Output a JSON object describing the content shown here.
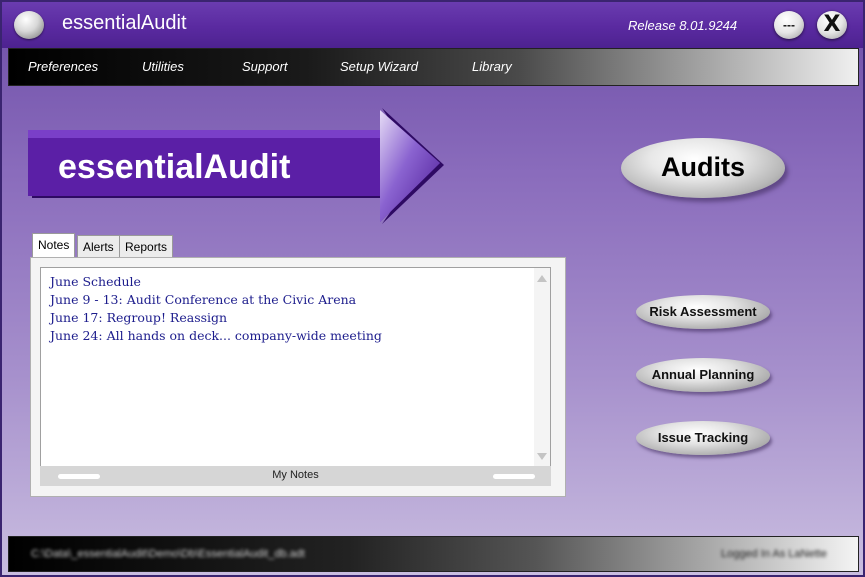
{
  "window": {
    "title": "essentialAudit",
    "release": "Release 8.01.9244",
    "minimize_label": "---",
    "close_label": "X"
  },
  "menu": {
    "items": [
      {
        "label": "Preferences"
      },
      {
        "label": "Utilities"
      },
      {
        "label": "Support"
      },
      {
        "label": "Setup Wizard"
      },
      {
        "label": "Library"
      }
    ]
  },
  "logo": {
    "text": "essentialAudit"
  },
  "buttons": {
    "audits": "Audits",
    "risk_assessment": "Risk Assessment",
    "annual_planning": "Annual Planning",
    "issue_tracking": "Issue Tracking"
  },
  "tabs": [
    {
      "label": "Notes",
      "active": true
    },
    {
      "label": "Alerts",
      "active": false
    },
    {
      "label": "Reports",
      "active": false
    }
  ],
  "notes": {
    "lines": [
      "June Schedule",
      "June 9 - 13:  Audit Conference at the Civic Arena",
      "June 17: Regroup!  Reassign",
      "June 24: All hands on deck... company-wide meeting"
    ],
    "footer_label": "My Notes"
  },
  "status": {
    "path": "C:\\Data\\_essentialAudit\\Demo\\Db\\EssentialAudit_db.adt",
    "user": "Logged In As LaNette"
  },
  "colors": {
    "accent_purple": "#5a2aa0",
    "logo_purple": "#5b1fa6",
    "note_text": "#1c1c8c"
  }
}
